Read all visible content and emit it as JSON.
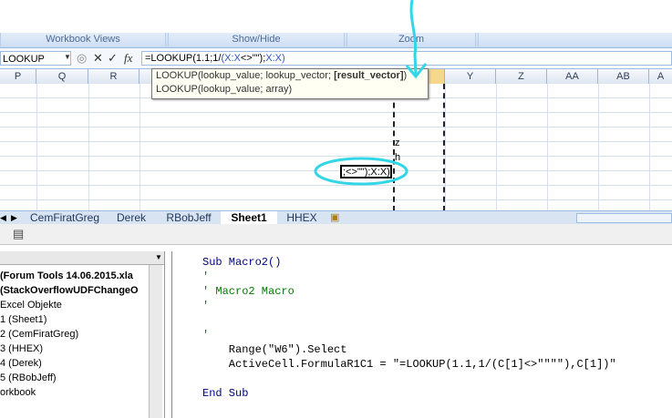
{
  "ribbon": {
    "groups": [
      "Workbook Views",
      "Show/Hide",
      "Zoom"
    ]
  },
  "formula_bar": {
    "name_box": "LOOKUP",
    "fx_label": "fx",
    "formula_prefix": "=LOOKUP(1.1;1/",
    "formula_ref": "(X:X",
    "formula_mid": "<>\"\");",
    "formula_end": "X:X)"
  },
  "columns": [
    "P",
    "Q",
    "R",
    "",
    "",
    "",
    "",
    "",
    "Y",
    "Z",
    "AA",
    "AB",
    "A"
  ],
  "tooltip": {
    "line1_prefix": "LOOKUP(lookup_value; lookup_vector; ",
    "line1_bold": "[result_vector]",
    "line1_suffix": ")",
    "line2": "LOOKUP(lookup_value; array)"
  },
  "cells": {
    "z": "z",
    "h": "h",
    "editing": ";<>\"\");X:X)"
  },
  "sheet_tabs": [
    "CemFiratGreg",
    "Derek",
    "RBobJeff",
    "Sheet1",
    "HHEX"
  ],
  "active_tab": "Sheet1",
  "project_tree": [
    "(Forum Tools 14.06.2015.xla",
    "(StackOverflowUDFChangeO",
    "Excel Objekte",
    "1 (Sheet1)",
    "2 (CemFiratGreg)",
    "3 (HHEX)",
    "4 (Derek)",
    "5 (RBobJeff)",
    "orkbook"
  ],
  "code_lines": [
    {
      "text": "Sub Macro2()",
      "kind": "kw"
    },
    {
      "text": "'",
      "kind": "comment"
    },
    {
      "text": "' Macro2 Macro",
      "kind": "comment"
    },
    {
      "text": "'",
      "kind": "comment"
    },
    {
      "text": "",
      "kind": "plain"
    },
    {
      "text": "'",
      "kind": "comment"
    },
    {
      "text": "    Range(\"W6\").Select",
      "kind": "plain"
    },
    {
      "text": "    ActiveCell.FormulaR1C1 = \"=LOOKUP(1.1,1/(C[1]<>\"\"\"\"),C[1])\"",
      "kind": "plain"
    },
    {
      "text": "",
      "kind": "plain"
    },
    {
      "text": "End Sub",
      "kind": "kw"
    }
  ],
  "annotation_color": "#33d6e6"
}
